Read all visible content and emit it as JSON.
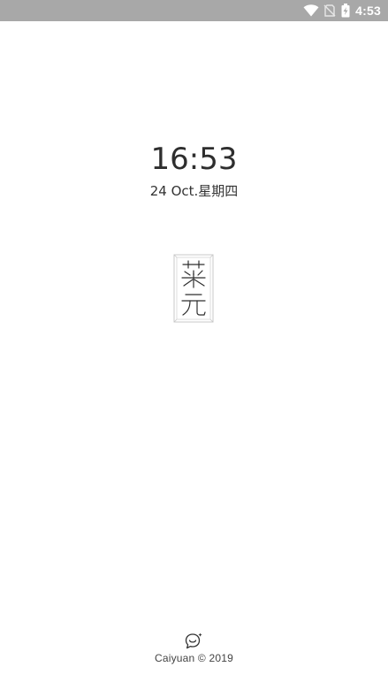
{
  "status_bar": {
    "time": "4:53",
    "icons": [
      "wifi-icon",
      "no-sim-icon",
      "battery-charging-icon"
    ]
  },
  "clock": {
    "time": "16:53",
    "date": "24 Oct.星期四"
  },
  "logo": {
    "text": "菜元"
  },
  "footer": {
    "icon": "smile-chat-icon",
    "copyright": "Caiyuan © 2019"
  },
  "colors": {
    "status_bar_bg": "#a8a8a8",
    "background": "#ffffff",
    "text": "#2e2e2e"
  }
}
